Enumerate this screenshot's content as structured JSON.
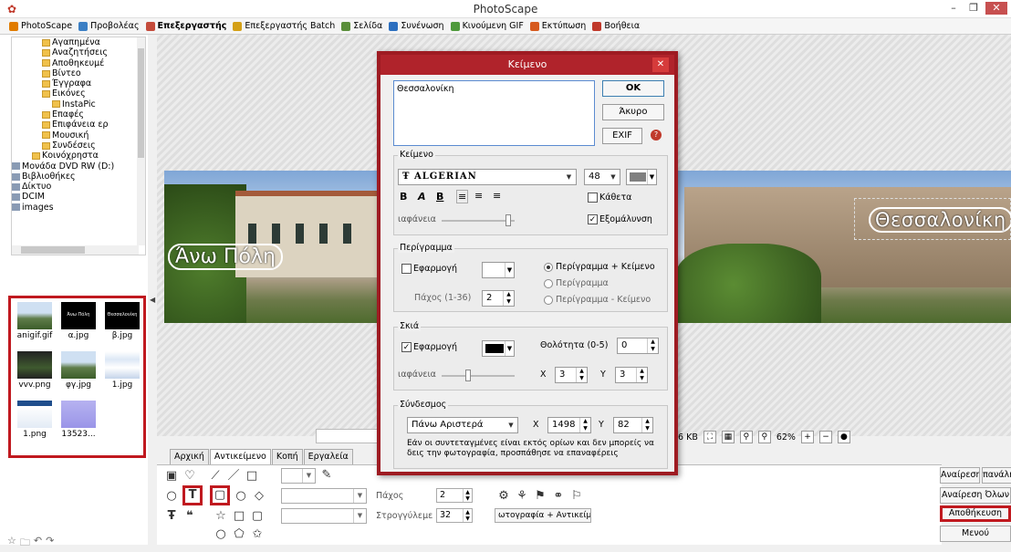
{
  "window": {
    "title": "PhotoScape",
    "controls": [
      "–",
      "❐",
      "✕"
    ]
  },
  "menu": [
    {
      "label": "PhotoScape",
      "color": "#e07b00",
      "active": false
    },
    {
      "label": "Προβολέας",
      "color": "#3b7fc4",
      "active": false
    },
    {
      "label": "Επεξεργαστής",
      "color": "#c44b3b",
      "active": true
    },
    {
      "label": "Επεξεργαστής Batch",
      "color": "#d4a017",
      "active": false
    },
    {
      "label": "Σελίδα",
      "color": "#5a8e3a",
      "active": false
    },
    {
      "label": "Συνένωση",
      "color": "#2c6fbf",
      "active": false
    },
    {
      "label": "Κινούμενη GIF",
      "color": "#4f9a3c",
      "active": false
    },
    {
      "label": "Εκτύπωση",
      "color": "#d65a1f",
      "active": false
    },
    {
      "label": "Βοήθεια",
      "color": "#c0392b",
      "active": false
    }
  ],
  "tree": [
    {
      "label": "Αγαπημένα",
      "indent": 3
    },
    {
      "label": "Αναζητήσεις",
      "indent": 3
    },
    {
      "label": "Αποθηκευμέ",
      "indent": 3
    },
    {
      "label": "Βίντεο",
      "indent": 3
    },
    {
      "label": "Έγγραφα",
      "indent": 3
    },
    {
      "label": "Εικόνες",
      "indent": 3
    },
    {
      "label": "InstaPic",
      "indent": 4
    },
    {
      "label": "Επαφές",
      "indent": 3
    },
    {
      "label": "Επιφάνεια ερ",
      "indent": 3
    },
    {
      "label": "Μουσική",
      "indent": 3
    },
    {
      "label": "Συνδέσεις",
      "indent": 3
    },
    {
      "label": "Κοινόχρηστα",
      "indent": 2
    },
    {
      "label": "Μονάδα DVD RW (D:)",
      "indent": 0
    },
    {
      "label": "Βιβλιοθήκες",
      "indent": 0
    },
    {
      "label": "Δίκτυο",
      "indent": 0
    },
    {
      "label": "DCIM",
      "indent": 0
    },
    {
      "label": "images",
      "indent": 0
    }
  ],
  "thumbnails": [
    {
      "name": "anigif.gif",
      "style": "pano"
    },
    {
      "name": "α.jpg",
      "style": "black-text",
      "text": "Άνω Πόλη"
    },
    {
      "name": "β.jpg",
      "style": "black-text",
      "text": "Θεσσαλονίκη"
    },
    {
      "name": "vvv.png",
      "style": "dark-pano"
    },
    {
      "name": "φγ.jpg",
      "style": "pano"
    },
    {
      "name": "1.jpg",
      "style": "doc"
    },
    {
      "name": "1.png",
      "style": "window"
    },
    {
      "name": "13523...",
      "style": "purple"
    }
  ],
  "photo": {
    "text_left": "Άνω Πόλη",
    "text_right": "Θεσσαλονίκη"
  },
  "status": {
    "file_size": ".6 KB",
    "zoom": "62%"
  },
  "tabs": [
    "Αρχική",
    "Αντικείμενο",
    "Κοπή",
    "Εργαλεία"
  ],
  "tool_panel": {
    "thickness_label": "Πάχος",
    "thickness_value": "2",
    "rounding_label": "Στρογγύλεμε",
    "rounding_value": "32",
    "photo_object_btn": "ωτογραφία + Αντικείμε"
  },
  "right_buttons": {
    "undo": "Αναίρεση",
    "redo": "πανάλη",
    "undo_all": "Αναίρεση Όλων",
    "save": "Αποθήκευση",
    "menu": "Μενού"
  },
  "dialog": {
    "title": "Κείμενο",
    "text_value": "Θεσσαλονίκη",
    "ok": "OK",
    "cancel": "Άκυρο",
    "exif": "EXIF",
    "text_group": {
      "title": "Κείμενο",
      "font": "ALGERIAN",
      "font_size": "48",
      "color": "#808080",
      "vertical_label": "Κάθετα",
      "vertical_checked": false,
      "opacity_label": "ιαφάνεια",
      "opacity_value": 0.95,
      "antialias_label": "Εξομάλυνση",
      "antialias_checked": true
    },
    "border_group": {
      "title": "Περίγραμμα",
      "apply_label": "Εφαρμογή",
      "apply_checked": false,
      "thickness_label": "Πάχος (1-36)",
      "thickness_value": "2",
      "opt1": "Περίγραμμα + Κείμενο",
      "opt2": "Περίγραμμα",
      "opt3": "Περίγραμμα - Κείμενο",
      "selected": 1
    },
    "shadow_group": {
      "title": "Σκιά",
      "apply_label": "Εφαρμογή",
      "apply_checked": true,
      "color": "#000000",
      "sharpness_label": "Θολότητα (0-5)",
      "sharpness_value": "0",
      "opacity_label": "ιαφάνεια",
      "opacity_value": 0.35,
      "x_label": "X",
      "x_value": "3",
      "y_label": "Y",
      "y_value": "3"
    },
    "anchor_group": {
      "title": "Σύνδεσμος",
      "position": "Πάνω Αριστερά",
      "x_label": "X",
      "x_value": "1498",
      "y_label": "Y",
      "y_value": "82",
      "note": "Εάν οι συντεταγμένες είναι εκτός ορίων και δεν μπορείς να δεις την φωτογραφία, προσπάθησε να επαναφέρεις"
    }
  }
}
